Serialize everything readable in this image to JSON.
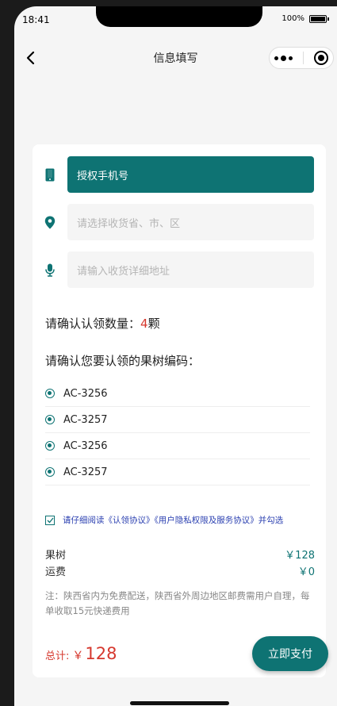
{
  "status": {
    "time": "18:41",
    "battery": "100%"
  },
  "nav": {
    "title": "信息填写"
  },
  "form": {
    "phone_button": "授权手机号",
    "region_placeholder": "请选择收货省、市、区",
    "address_placeholder": "请输入收货详细地址"
  },
  "adopt": {
    "count_prefix": "请确认认领数量：",
    "count_value": "4",
    "count_unit": "颗",
    "codes_heading": "请确认您要认领的果树编码：",
    "codes": [
      "AC-3256",
      "AC-3257",
      "AC-3256",
      "AC-3257"
    ]
  },
  "agreement": {
    "text": "请仔细阅读《认领协议》《用户隐私权限及服务协议》并勾选"
  },
  "pricing": {
    "fruit_label": "果树",
    "fruit_value": "￥128",
    "shipping_label": "运费",
    "shipping_value": "￥0",
    "note": "注：陕西省内为免费配送，陕西省外周边地区邮费需用户自理，每单收取15元快递费用"
  },
  "total": {
    "label": "总计:",
    "currency": "￥",
    "value": "128"
  },
  "pay_button": "立即支付",
  "colors": {
    "primary": "#0e7373",
    "accent_red": "#d6382e",
    "link_blue": "#2a3fb0"
  }
}
